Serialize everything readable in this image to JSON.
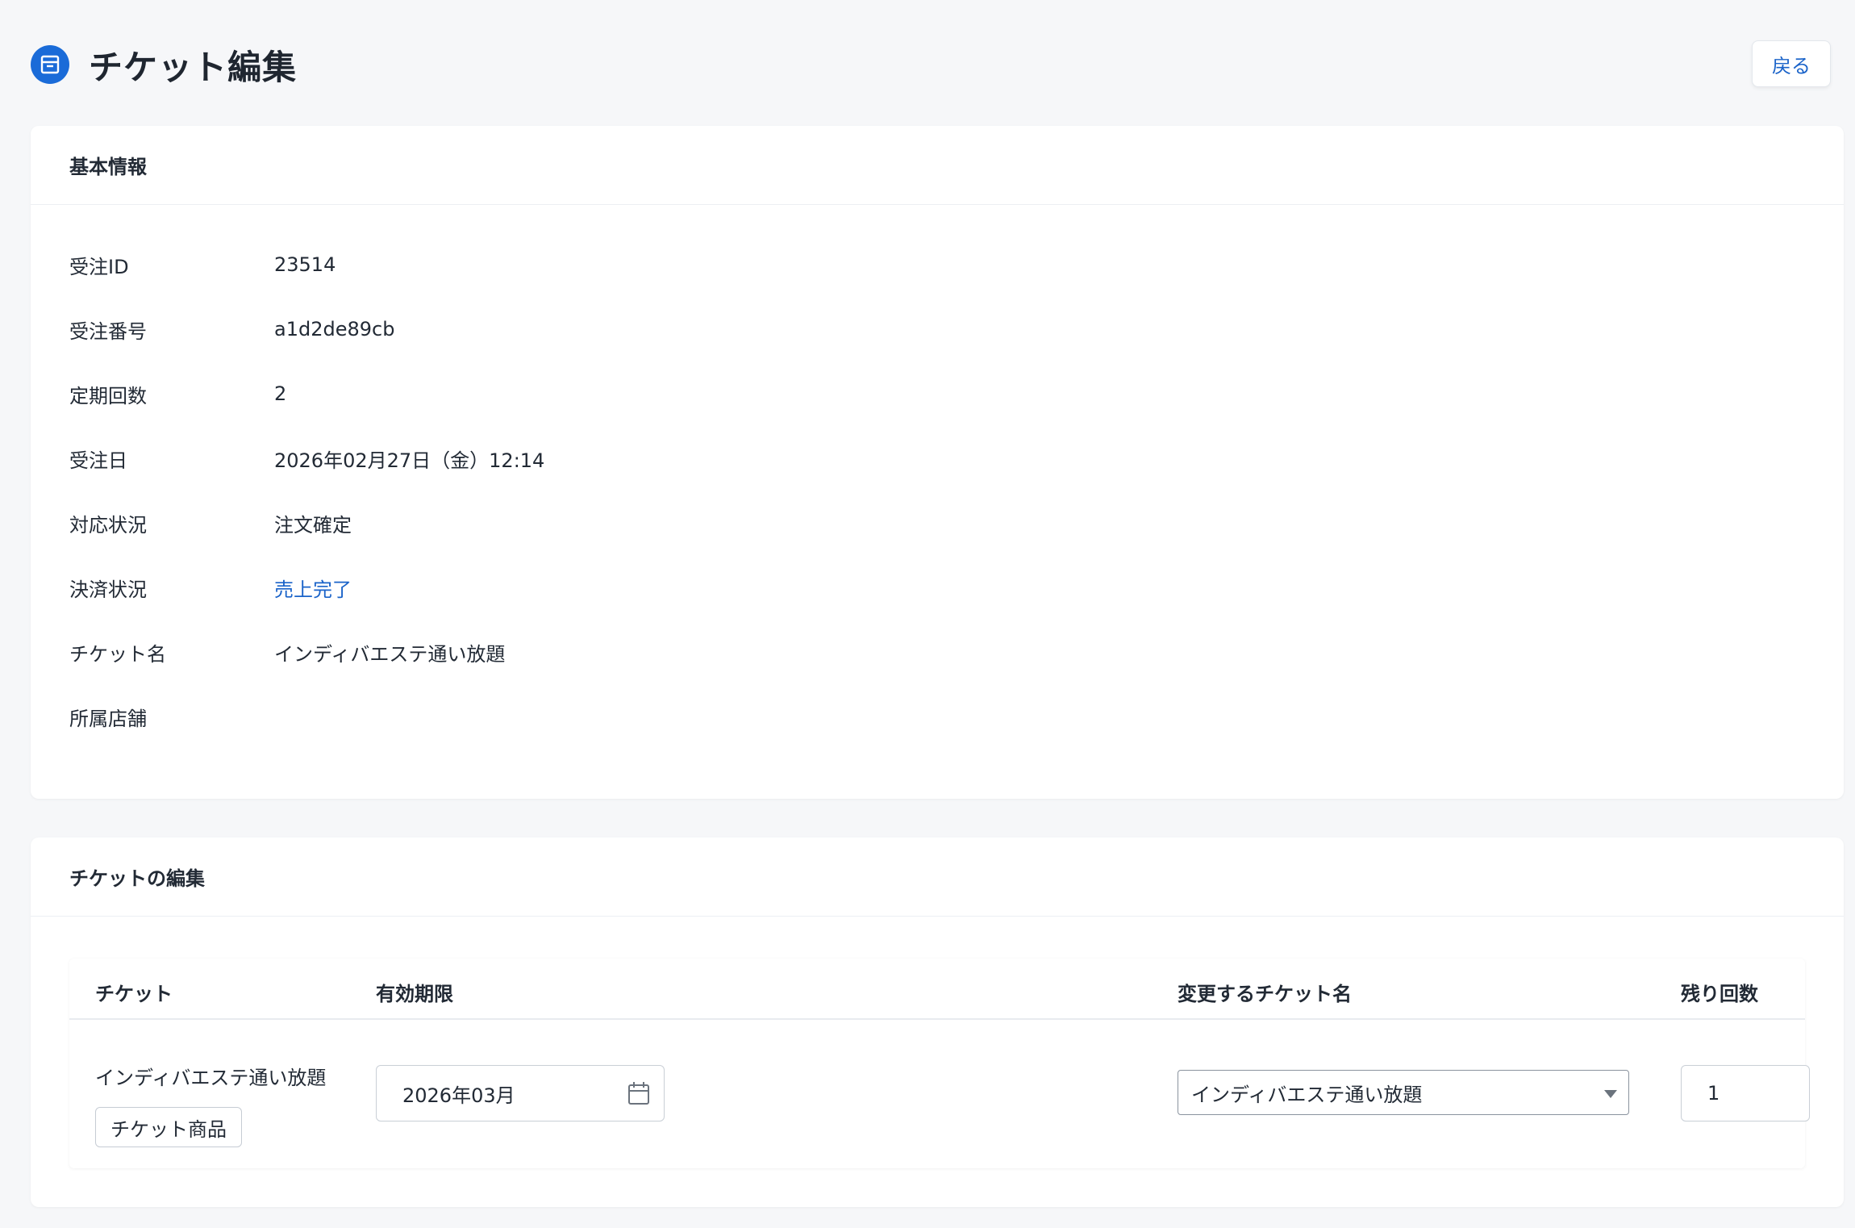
{
  "header": {
    "title": "チケット編集",
    "back_label": "戻る"
  },
  "basic_info": {
    "section_title": "基本情報",
    "rows": [
      {
        "label": "受注ID",
        "value": "23514"
      },
      {
        "label": "受注番号",
        "value": "a1d2de89cb"
      },
      {
        "label": "定期回数",
        "value": "2"
      },
      {
        "label": "受注日",
        "value": "2026年02月27日（金）12:14"
      },
      {
        "label": "対応状況",
        "value": "注文確定"
      },
      {
        "label": "決済状況",
        "value": "売上完了"
      },
      {
        "label": "チケット名",
        "value": "インディバエステ通い放題"
      },
      {
        "label": "所属店舗",
        "value": ""
      }
    ]
  },
  "ticket_edit": {
    "section_title": "チケットの編集",
    "columns": [
      "チケット",
      "有効期限",
      "変更するチケット名",
      "残り回数"
    ],
    "row": {
      "ticket_name": "インディバエステ通い放題",
      "badge": "チケット商品",
      "expiry_value": "2026年03月",
      "selected_ticket": "インディバエステ通い放題",
      "remaining": "1"
    }
  },
  "colors": {
    "accent": "#1a6bd8",
    "link": "#1a63c9",
    "background": "#f6f7f9"
  },
  "icons": {
    "title": "archive-box-icon",
    "date": "calendar-icon",
    "select": "chevron-down-icon"
  }
}
